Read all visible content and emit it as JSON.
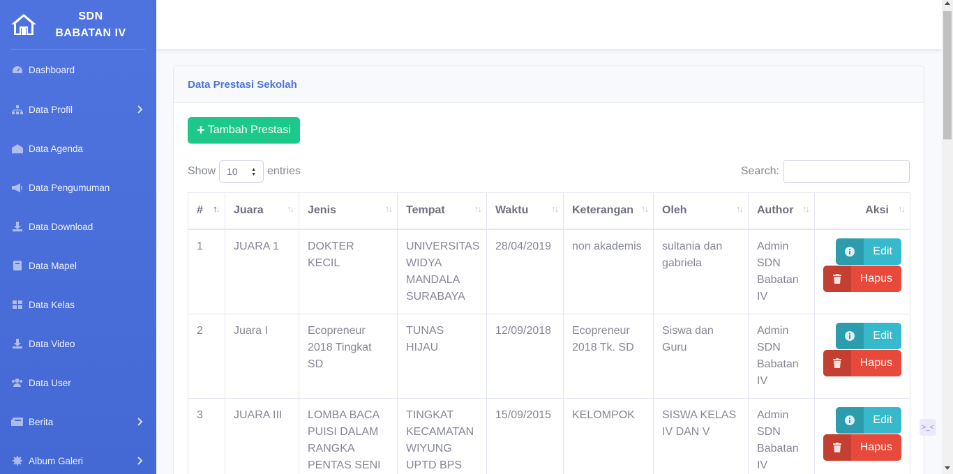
{
  "brand": {
    "line1": "SDN",
    "line2": "BABATAN IV"
  },
  "sidebar": {
    "items": [
      {
        "label": "Dashboard",
        "icon": "dashboard-icon",
        "chevron": false
      },
      {
        "label": "Data Profil",
        "icon": "sitemap-icon",
        "chevron": true
      },
      {
        "label": "Data Agenda",
        "icon": "school-icon",
        "chevron": false
      },
      {
        "label": "Data Pengumuman",
        "icon": "bullhorn-icon",
        "chevron": false
      },
      {
        "label": "Data Download",
        "icon": "download-icon",
        "chevron": false
      },
      {
        "label": "Data Mapel",
        "icon": "book-icon",
        "chevron": false
      },
      {
        "label": "Data Kelas",
        "icon": "grid-icon",
        "chevron": false
      },
      {
        "label": "Data Video",
        "icon": "download-icon",
        "chevron": false
      },
      {
        "label": "Data User",
        "icon": "users-icon",
        "chevron": false
      },
      {
        "label": "Berita",
        "icon": "newspaper-icon",
        "chevron": true
      },
      {
        "label": "Album Galeri",
        "icon": "cog-icon",
        "chevron": true
      }
    ]
  },
  "card": {
    "title": "Data Prestasi Sekolah"
  },
  "add_button": "Tambah Prestasi",
  "datatable": {
    "show_label": "Show",
    "entries_label": "entries",
    "length_value": "10",
    "search_label": "Search:",
    "search_value": ""
  },
  "table": {
    "headers": [
      "#",
      "Juara",
      "Jenis",
      "Tempat",
      "Waktu",
      "Keterangan",
      "Oleh",
      "Author",
      "Aksi"
    ],
    "rows": [
      {
        "no": "1",
        "juara": "JUARA 1",
        "jenis": "DOKTER KECIL",
        "tempat": "UNIVERSITAS WIDYA MANDALA SURABAYA",
        "waktu": "28/04/2019",
        "keterangan": "non akademis",
        "oleh": "sultania dan gabriela",
        "author": "Admin SDN Babatan IV"
      },
      {
        "no": "2",
        "juara": "Juara I",
        "jenis": "Ecopreneur 2018 Tingkat SD",
        "tempat": "TUNAS HIJAU",
        "waktu": "12/09/2018",
        "keterangan": "Ecopreneur 2018 Tk. SD",
        "oleh": "Siswa dan Guru",
        "author": "Admin SDN Babatan IV"
      },
      {
        "no": "3",
        "juara": "JUARA III",
        "jenis": "LOMBA BACA PUISI DALAM RANGKA PENTAS SENI",
        "tempat": "TINGKAT KECAMATAN WIYUNG UPTD BPS",
        "waktu": "15/09/2015",
        "keterangan": "KELOMPOK",
        "oleh": "SISWA KELAS IV DAN V",
        "author": "Admin SDN Babatan IV"
      }
    ],
    "edit_label": "Edit",
    "delete_label": "Hapus"
  },
  "colors": {
    "primary": "#4e73df",
    "success": "#1cc88a",
    "info": "#36b9cc",
    "danger": "#e74a3b"
  }
}
